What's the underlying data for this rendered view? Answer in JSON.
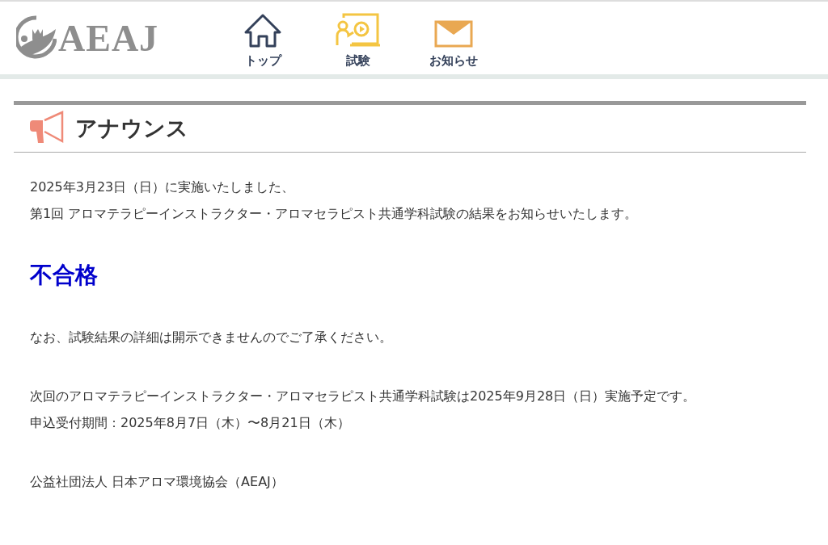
{
  "header": {
    "logo": "AEAJ",
    "nav": [
      {
        "kind": "home",
        "label": "トップ"
      },
      {
        "kind": "exam",
        "label": "試験"
      },
      {
        "kind": "mail",
        "label": "お知らせ"
      }
    ]
  },
  "announcement": {
    "title": "アナウンス",
    "blocks": [
      {
        "kind": "text",
        "lines": [
          "2025年3月23日（日）に実施いたしました、",
          "第1回 アロマテラピーインストラクター・アロマセラピスト共通学科試験の結果をお知らせいたします。"
        ]
      },
      {
        "kind": "result",
        "lines": [
          "不合格"
        ]
      },
      {
        "kind": "text",
        "lines": [
          "なお、試験結果の詳細は開示できませんのでご了承ください。"
        ]
      },
      {
        "kind": "text",
        "lines": [
          "次回のアロマテラピーインストラクター・アロマセラピスト共通学科試験は2025年9月28日（日）実施予定です。",
          "申込受付期間：2025年8月7日（木）〜8月21日（木）"
        ]
      },
      {
        "kind": "text",
        "lines": [
          "公益社団法人 日本アロマ環境協会（AEAJ）"
        ]
      }
    ]
  }
}
